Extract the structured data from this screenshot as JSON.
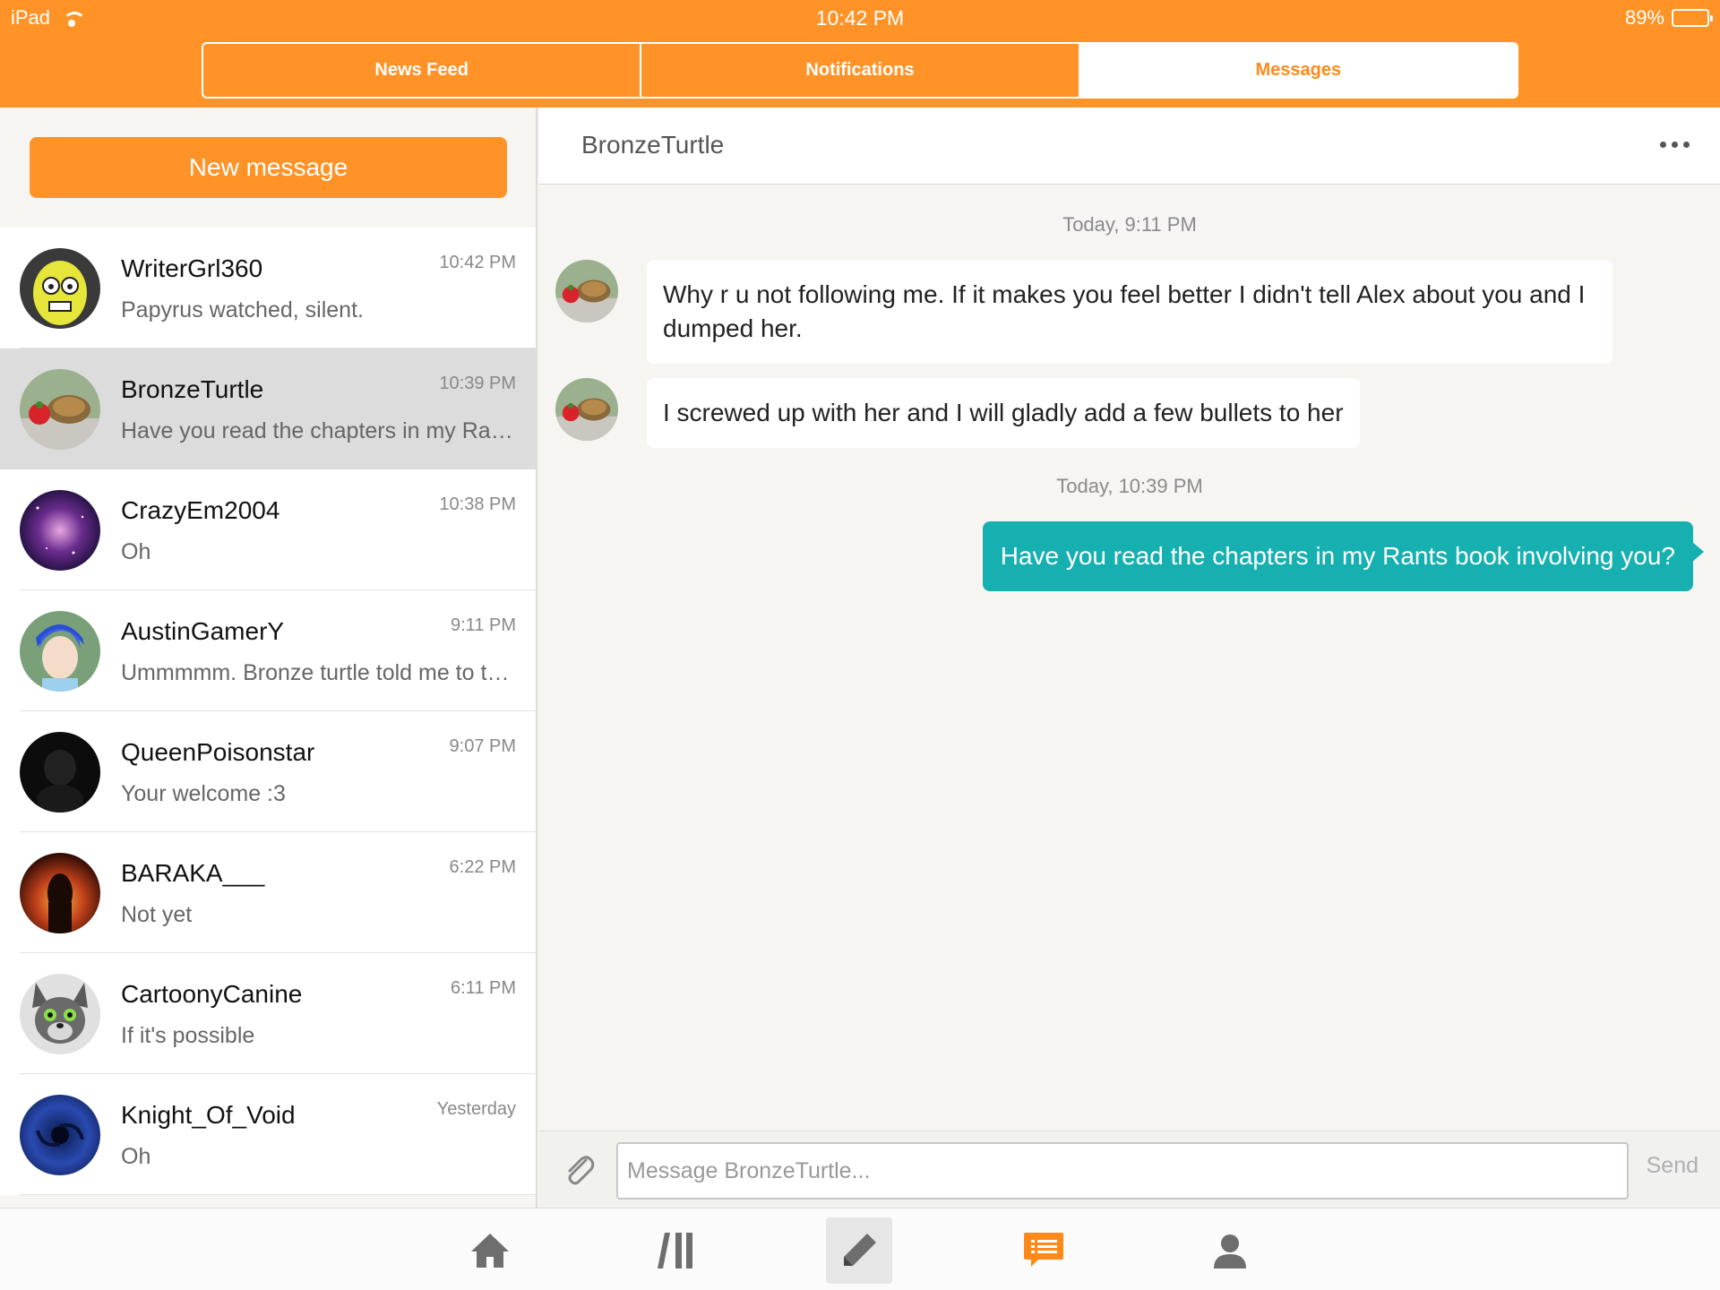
{
  "status_bar": {
    "device": "iPad",
    "time": "10:42 PM",
    "battery": "89%",
    "battery_level": 0.89
  },
  "top_tabs": [
    {
      "label": "News Feed",
      "active": false
    },
    {
      "label": "Notifications",
      "active": false
    },
    {
      "label": "Messages",
      "active": true
    }
  ],
  "sidebar": {
    "new_message_label": "New message",
    "conversations": [
      {
        "name": "WriterGrl360",
        "preview": "Papyrus watched, silent.",
        "time": "10:42 PM",
        "selected": false
      },
      {
        "name": "BronzeTurtle",
        "preview": "Have you read the chapters in my Rants book involving you?",
        "time": "10:39 PM",
        "selected": true
      },
      {
        "name": "CrazyEm2004",
        "preview": "Oh",
        "time": "10:38 PM",
        "selected": false
      },
      {
        "name": "AustinGamerY",
        "preview": "Ummmmm. Bronze turtle told me to tell you something",
        "time": "9:11 PM",
        "selected": false
      },
      {
        "name": "QueenPoisonstar",
        "preview": "Your welcome :3",
        "time": "9:07 PM",
        "selected": false
      },
      {
        "name": "BARAKA___",
        "preview": "Not yet",
        "time": "6:22 PM",
        "selected": false
      },
      {
        "name": "CartoonyCanine",
        "preview": "If it's possible",
        "time": "6:11 PM",
        "selected": false
      },
      {
        "name": "Knight_Of_Void",
        "preview": "Oh",
        "time": "Yesterday",
        "selected": false
      }
    ]
  },
  "chat": {
    "title": "BronzeTurtle",
    "groups": [
      {
        "date": "Today, 9:11 PM"
      },
      {
        "date": "Today, 10:39 PM"
      }
    ],
    "messages": [
      {
        "direction": "in",
        "text": "Why r u not following me. If it makes you feel better I didn't tell Alex about you and I dumped her."
      },
      {
        "direction": "in",
        "text": "I screwed up with her and I will gladly add a few bullets to her"
      },
      {
        "direction": "out",
        "text": "Have you read the chapters in my Rants book involving you?"
      }
    ],
    "composer": {
      "placeholder": "Message BronzeTurtle...",
      "value": "",
      "send_label": "Send"
    }
  },
  "bottom_tabs": [
    {
      "icon": "home-icon"
    },
    {
      "icon": "library-icon"
    },
    {
      "icon": "pencil-icon"
    },
    {
      "icon": "messages-icon",
      "active": true
    },
    {
      "icon": "profile-icon"
    }
  ],
  "colors": {
    "accent": "#ff9327",
    "outgoing_bubble": "#17b0b0",
    "selected_row": "#dcdcdc"
  }
}
